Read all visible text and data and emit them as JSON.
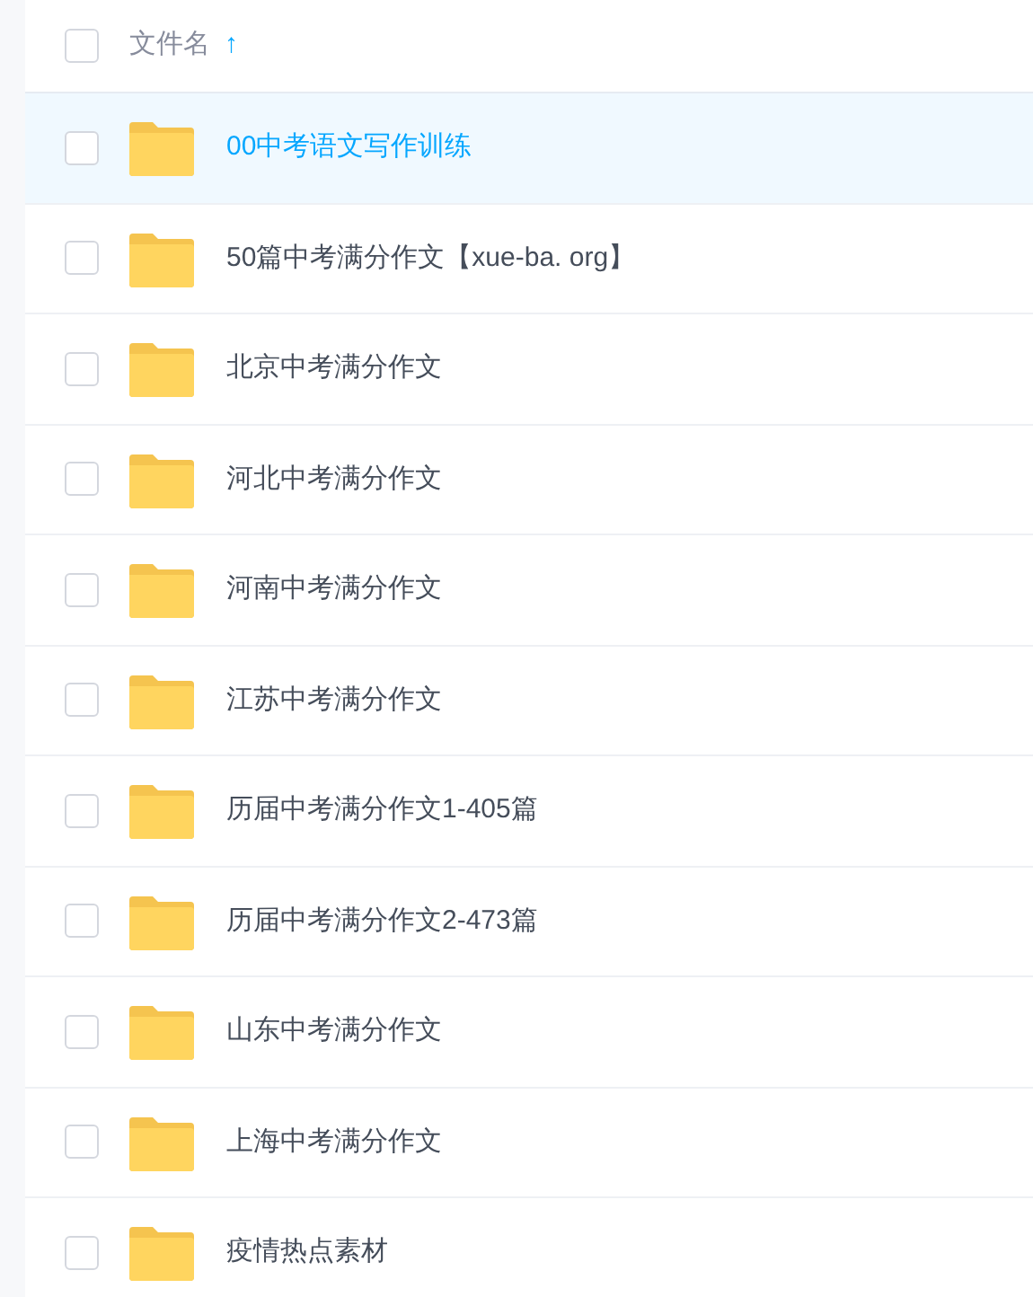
{
  "header": {
    "checked": false,
    "column_label": "文件名",
    "sort_icon": "↑"
  },
  "rows": [
    {
      "name": "00中考语文写作训练",
      "selected": true,
      "checked": false
    },
    {
      "name": "50篇中考满分作文【xue-ba. org】",
      "selected": false,
      "checked": false
    },
    {
      "name": "北京中考满分作文",
      "selected": false,
      "checked": false
    },
    {
      "name": "河北中考满分作文",
      "selected": false,
      "checked": false
    },
    {
      "name": "河南中考满分作文",
      "selected": false,
      "checked": false
    },
    {
      "name": "江苏中考满分作文",
      "selected": false,
      "checked": false
    },
    {
      "name": "历届中考满分作文1-405篇",
      "selected": false,
      "checked": false
    },
    {
      "name": "历届中考满分作文2-473篇",
      "selected": false,
      "checked": false
    },
    {
      "name": "山东中考满分作文",
      "selected": false,
      "checked": false
    },
    {
      "name": "上海中考满分作文",
      "selected": false,
      "checked": false
    },
    {
      "name": "疫情热点素材",
      "selected": false,
      "checked": false
    }
  ]
}
